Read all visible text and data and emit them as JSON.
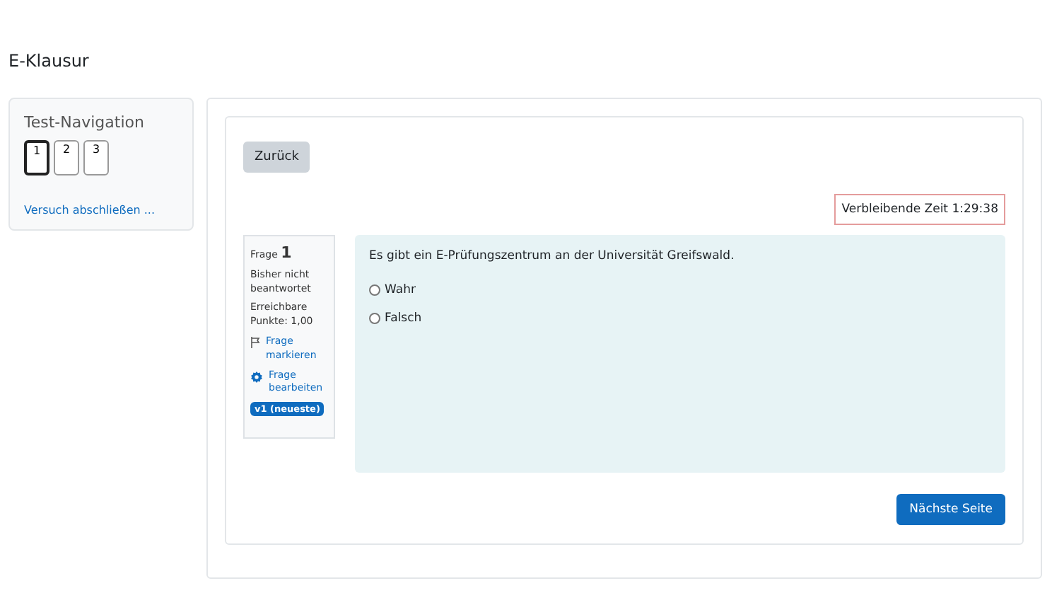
{
  "page_title": "E-Klausur",
  "navigation": {
    "title": "Test-Navigation",
    "questions": [
      {
        "label": "1",
        "selected": true
      },
      {
        "label": "2",
        "selected": false
      },
      {
        "label": "3",
        "selected": false
      }
    ],
    "finish_link": "Versuch abschließen ..."
  },
  "back_button": "Zurück",
  "timer": "Verbleibende Zeit 1:29:38",
  "question_info": {
    "label": "Frage",
    "number": "1",
    "status": "Bisher nicht beantwortet",
    "points": "Erreichbare Punkte: 1,00",
    "flag_link": "Frage markieren",
    "edit_link": "Frage bearbeiten",
    "version_badge": "v1 (neueste)"
  },
  "question": {
    "text": "Es gibt ein E-Prüfungszentrum an der Universität Greifswald.",
    "options": [
      {
        "label": "Wahr",
        "selected": false
      },
      {
        "label": "Falsch",
        "selected": false
      }
    ]
  },
  "next_button": "Nächste Seite"
}
